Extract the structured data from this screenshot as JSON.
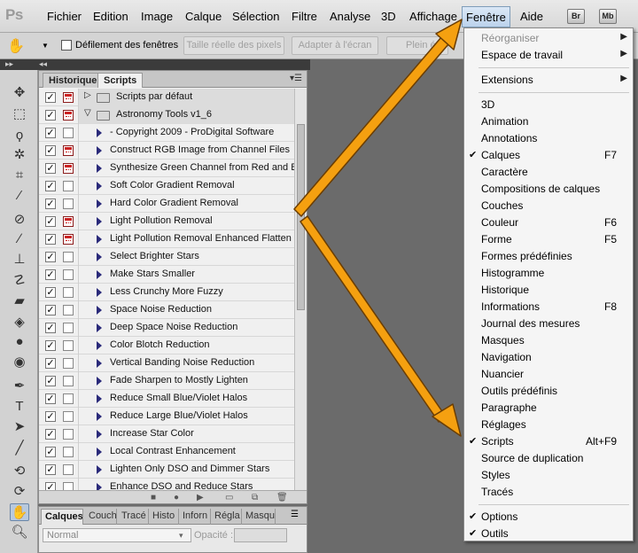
{
  "menubar": {
    "logo": "Ps",
    "items": [
      "Fichier",
      "Edition",
      "Image",
      "Calque",
      "Sélection",
      "Filtre",
      "Analyse",
      "3D",
      "Affichage",
      "Fenêtre",
      "Aide"
    ],
    "bridge_label": "Br",
    "minibridge_label": "Mb"
  },
  "options": {
    "scroll_all_label": "Défilement des fenêtres",
    "actual_pixels": "Taille réelle des pixels",
    "fit_screen": "Adapter à l'écran",
    "fill_screen": "Plein é"
  },
  "panel": {
    "tabs": [
      "Historique",
      "Scripts"
    ],
    "active_tab": "Scripts",
    "rows": [
      {
        "kind": "set",
        "label": "Scripts par défaut",
        "dialog": true,
        "expanded": false
      },
      {
        "kind": "set",
        "label": "Astronomy Tools v1_6",
        "dialog": true,
        "expanded": true
      },
      {
        "kind": "action",
        "label": "- Copyright 2009 - ProDigital Software",
        "dialog": false
      },
      {
        "kind": "action",
        "label": "Construct RGB Image from Channel Files",
        "dialog": true
      },
      {
        "kind": "action",
        "label": "Synthesize Green Channel from Red and Bl...",
        "dialog": true
      },
      {
        "kind": "action",
        "label": "Soft Color Gradient Removal",
        "dialog": false
      },
      {
        "kind": "action",
        "label": "Hard Color Gradient Removal",
        "dialog": false
      },
      {
        "kind": "action",
        "label": "Light Pollution Removal",
        "dialog": true
      },
      {
        "kind": "action",
        "label": "Light Pollution Removal Enhanced Flatten",
        "dialog": true
      },
      {
        "kind": "action",
        "label": "Select Brighter Stars",
        "dialog": false
      },
      {
        "kind": "action",
        "label": "Make Stars Smaller",
        "dialog": false
      },
      {
        "kind": "action",
        "label": "Less Crunchy More Fuzzy",
        "dialog": false
      },
      {
        "kind": "action",
        "label": "Space Noise Reduction",
        "dialog": false
      },
      {
        "kind": "action",
        "label": "Deep Space Noise Reduction",
        "dialog": false
      },
      {
        "kind": "action",
        "label": "Color Blotch Reduction",
        "dialog": false
      },
      {
        "kind": "action",
        "label": "Vertical Banding Noise Reduction",
        "dialog": false
      },
      {
        "kind": "action",
        "label": "Fade Sharpen to Mostly Lighten",
        "dialog": false
      },
      {
        "kind": "action",
        "label": "Reduce Small Blue/Violet Halos",
        "dialog": false
      },
      {
        "kind": "action",
        "label": "Reduce Large Blue/Violet Halos",
        "dialog": false
      },
      {
        "kind": "action",
        "label": "Increase Star Color",
        "dialog": false
      },
      {
        "kind": "action",
        "label": "Local Contrast Enhancement",
        "dialog": false
      },
      {
        "kind": "action",
        "label": "Lighten Only DSO and Dimmer Stars",
        "dialog": false
      },
      {
        "kind": "action",
        "label": "Enhance DSO and Reduce Stars",
        "dialog": false
      }
    ]
  },
  "layers": {
    "tabs": [
      "Calques",
      "Couch",
      "Tracé",
      "Histo",
      "Inforn",
      "Régla",
      "Masqu"
    ],
    "blend_mode": "Normal",
    "opacity_label": "Opacité :"
  },
  "dropdown": {
    "items": [
      {
        "label": "Réorganiser",
        "disabled": true,
        "submenu": true
      },
      {
        "label": "Espace de travail",
        "submenu": true
      },
      {
        "sep": true
      },
      {
        "label": "Extensions",
        "submenu": true
      },
      {
        "sep": true
      },
      {
        "label": "3D"
      },
      {
        "label": "Animation"
      },
      {
        "label": "Annotations"
      },
      {
        "label": "Calques",
        "checked": true,
        "shortcut": "F7"
      },
      {
        "label": "Caractère"
      },
      {
        "label": "Compositions de calques"
      },
      {
        "label": "Couches"
      },
      {
        "label": "Couleur",
        "shortcut": "F6"
      },
      {
        "label": "Forme",
        "shortcut": "F5"
      },
      {
        "label": "Formes prédéfinies"
      },
      {
        "label": "Histogramme"
      },
      {
        "label": "Historique"
      },
      {
        "label": "Informations",
        "shortcut": "F8"
      },
      {
        "label": "Journal des mesures"
      },
      {
        "label": "Masques"
      },
      {
        "label": "Navigation"
      },
      {
        "label": "Nuancier"
      },
      {
        "label": "Outils prédéfinis"
      },
      {
        "label": "Paragraphe"
      },
      {
        "label": "Réglages"
      },
      {
        "label": "Scripts",
        "checked": true,
        "shortcut": "Alt+F9"
      },
      {
        "label": "Source de duplication"
      },
      {
        "label": "Styles"
      },
      {
        "label": "Tracés"
      },
      {
        "sep": true
      },
      {
        "label": "Options",
        "checked": true
      },
      {
        "label": "Outils",
        "checked": true
      }
    ]
  },
  "colors": {
    "arrow": "#f5a010",
    "arrow_outline": "#6b3d00",
    "menu_highlight": "#bcd3ec",
    "dialog_icon": "#cc2222"
  }
}
